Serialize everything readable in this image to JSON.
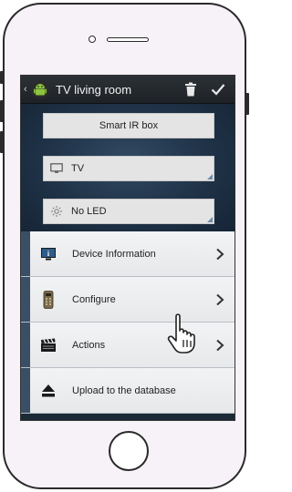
{
  "app": {
    "title": "TV living room",
    "icons": {
      "app": "android-logo-icon",
      "delete": "trash-icon",
      "confirm": "checkmark-icon"
    }
  },
  "fields": [
    {
      "label": "Smart IR box",
      "icon": null
    },
    {
      "label": "TV",
      "icon": "monitor-icon"
    },
    {
      "label": "No LED",
      "icon": "led-icon"
    }
  ],
  "menu": [
    {
      "label": "Device Information",
      "icon": "info-icon",
      "has_chevron": true
    },
    {
      "label": "Configure",
      "icon": "remote-control-icon",
      "has_chevron": true
    },
    {
      "label": "Actions",
      "icon": "clapperboard-icon",
      "has_chevron": true
    },
    {
      "label": "Upload to the database",
      "icon": "upload-icon",
      "has_chevron": false
    }
  ],
  "colors": {
    "action_bar": "#24292e",
    "panel": "#1f3247",
    "list_bg": "#edeff1",
    "accent_strip": "#3a4e66"
  }
}
